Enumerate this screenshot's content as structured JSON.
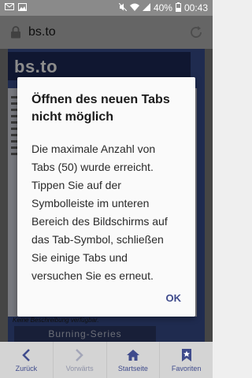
{
  "status_bar": {
    "battery": "40%",
    "time": "00:43"
  },
  "browser": {
    "url": "bs.to"
  },
  "webpage": {
    "logo": "bs.to",
    "footer_text": "Keine Beschreibung verfügbar.",
    "banner": "Burning-Series"
  },
  "dialog": {
    "title": "Öffnen des neuen Tabs nicht möglich",
    "message": "Die maximale Anzahl von Tabs (50) wurde erreicht. Tippen Sie auf der Symbolleiste im unteren Bereich des Bildschirms auf das Tab-Symbol, schließen Sie einige Tabs und versuchen Sie es erneut.",
    "ok_label": "OK"
  },
  "toolbar": {
    "back_label": "Zurück",
    "forward_label": "Vorwärts",
    "home_label": "Startseite",
    "bookmarks_label": "Favoriten"
  },
  "colors": {
    "accent": "#3f4b8c",
    "status_bar": "#8a8a8a",
    "address_bar": "#b8b8b8"
  }
}
